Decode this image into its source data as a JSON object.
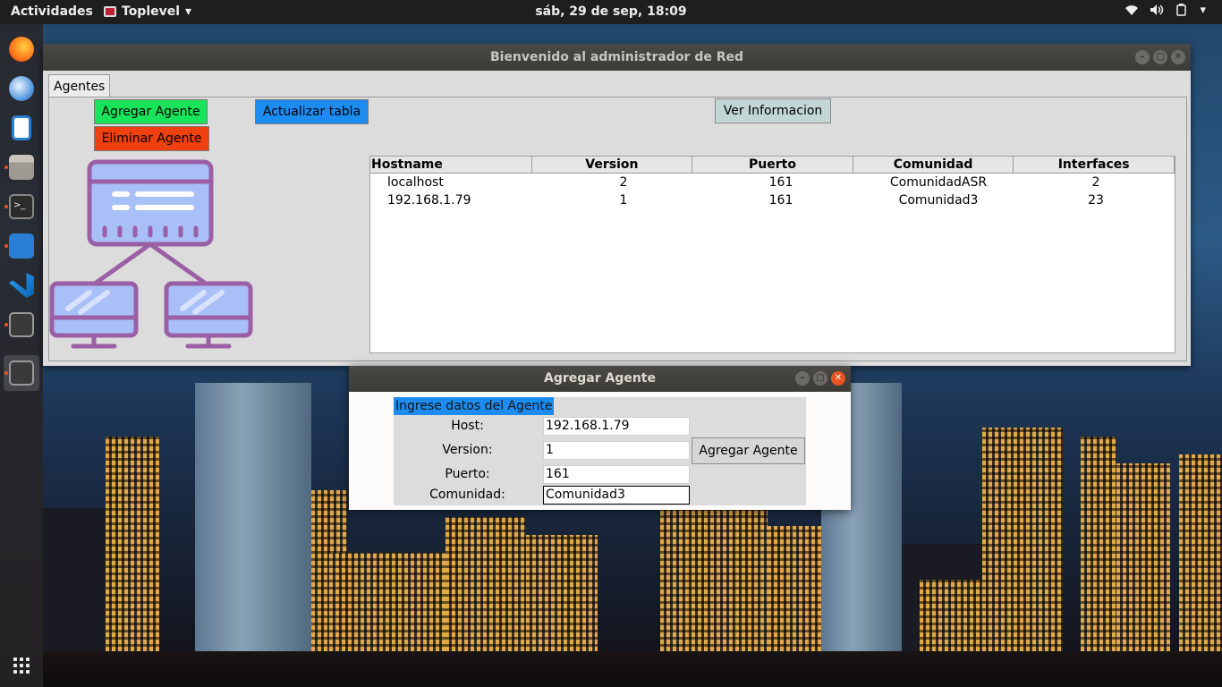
{
  "topbar": {
    "activities": "Actividades",
    "app_name": "Toplevel",
    "clock": "sáb, 29 de sep, 18:09"
  },
  "dock": {
    "items": [
      "firefox",
      "thunderbird",
      "writer",
      "files",
      "terminal",
      "system-monitor",
      "vscode",
      "tk-app-1",
      "tk-app-2"
    ]
  },
  "main_window": {
    "title": "Bienvenido al administrador de Red",
    "tab": "Agentes",
    "buttons": {
      "add": "Agregar Agente",
      "delete": "Eliminar Agente",
      "refresh": "Actualizar tabla",
      "info": "Ver Informacion"
    },
    "table": {
      "columns": [
        "Hostname",
        "Version",
        "Puerto",
        "Comunidad",
        "Interfaces"
      ],
      "rows": [
        [
          "localhost",
          "2",
          "161",
          "ComunidadASR",
          "2"
        ],
        [
          "192.168.1.79",
          "1",
          "161",
          "Comunidad3",
          "23"
        ]
      ]
    }
  },
  "dialog": {
    "title": "Agregar Agente",
    "frame_title": "Ingrese datos del Agente",
    "labels": {
      "host": "Host:",
      "version": "Version:",
      "port": "Puerto:",
      "community": "Comunidad:"
    },
    "values": {
      "host": "192.168.1.79",
      "version": "1",
      "port": "161",
      "community": "Comunidad3"
    },
    "submit": "Agregar Agente"
  },
  "colors": {
    "add_button": "#19e35a",
    "delete_button": "#f0400f",
    "refresh_button": "#1c8cf0",
    "info_button": "#c3d6d6",
    "illustration": "#9b5fa6",
    "illustration_screen": "#a8bff8"
  }
}
